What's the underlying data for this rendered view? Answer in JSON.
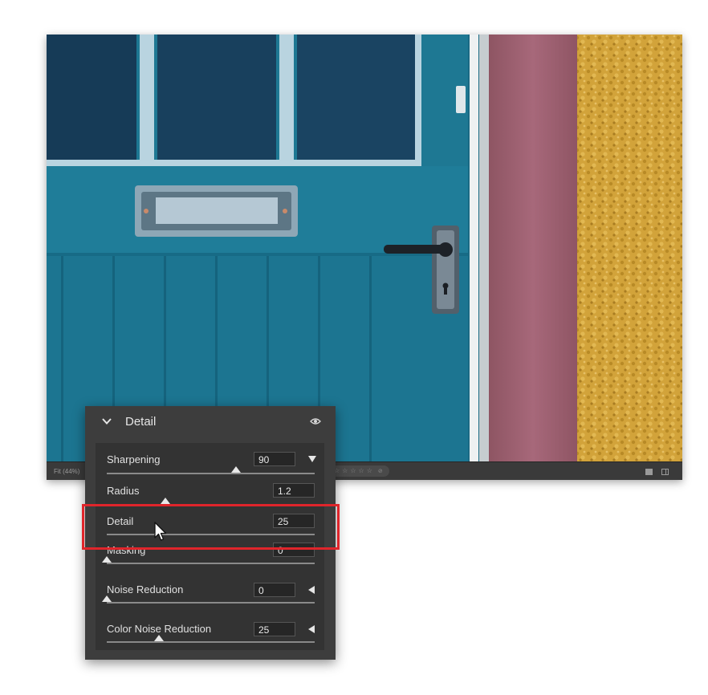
{
  "photo": {
    "zoom_label": "Fit (44%)",
    "rating_stars": [
      "☆",
      "☆",
      "☆",
      "☆",
      "☆"
    ],
    "rating_clear": "⊘",
    "view_single_icon": "single-view-icon",
    "view_compare_icon": "before-after-icon"
  },
  "panel": {
    "title": "Detail",
    "collapse_icon": "chevron-down-icon",
    "visibility_icon": "eye-icon",
    "sliders": [
      {
        "label": "Sharpening",
        "value": "90",
        "level": 0.62,
        "arrow": "down"
      },
      {
        "label": "Radius",
        "value": "1.2",
        "level": 0.28
      },
      {
        "label": "Detail",
        "value": "25",
        "level": 0.25
      },
      {
        "label": "Masking",
        "value": "0",
        "level": 0.0
      },
      {
        "label": "Noise Reduction",
        "value": "0",
        "level": 0.0,
        "arrow": "left"
      },
      {
        "label": "Color Noise Reduction",
        "value": "25",
        "level": 0.25,
        "arrow": "left"
      }
    ]
  },
  "colors": {
    "highlight": "#e0252b",
    "panel_bg": "#3d3d3d",
    "door": "#1f7a96",
    "pink_wall": "#a0626f",
    "yellow_wall": "#d2a33a"
  }
}
